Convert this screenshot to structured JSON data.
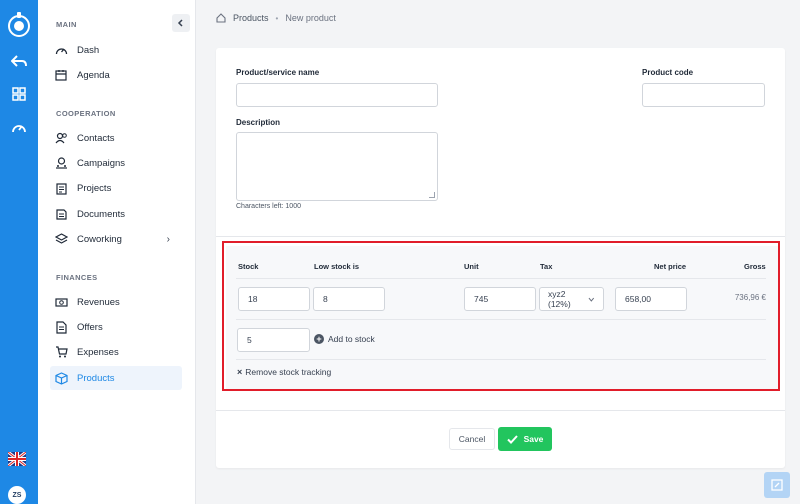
{
  "sidebar": {
    "sections": {
      "main": "MAIN",
      "cooperation": "COOPERATION",
      "finances": "FINANCES"
    },
    "items": [
      {
        "label": "Dash",
        "icon": "gauge-icon"
      },
      {
        "label": "Agenda",
        "icon": "calendar-icon"
      },
      {
        "label": "Contacts",
        "icon": "contacts-icon"
      },
      {
        "label": "Campaigns",
        "icon": "campaigns-icon"
      },
      {
        "label": "Projects",
        "icon": "clipboard-icon"
      },
      {
        "label": "Documents",
        "icon": "documents-icon"
      },
      {
        "label": "Coworking",
        "icon": "layers-icon"
      },
      {
        "label": "Revenues",
        "icon": "revenues-icon"
      },
      {
        "label": "Offers",
        "icon": "offers-icon"
      },
      {
        "label": "Expenses",
        "icon": "cart-icon"
      },
      {
        "label": "Products",
        "icon": "box-icon",
        "active": true
      }
    ]
  },
  "rail": {
    "avatar": "ZS"
  },
  "breadcrumb": {
    "parent": "Products",
    "current": "New product"
  },
  "form": {
    "name_label": "Product/service name",
    "name_value": "",
    "code_label": "Product code",
    "code_value": "",
    "description_label": "Description",
    "chars_left": "Characters left: 1000"
  },
  "stock": {
    "headers": {
      "stock": "Stock",
      "low_stock": "Low stock is",
      "unit": "Unit",
      "tax": "Tax",
      "net_price": "Net price",
      "gross": "Gross"
    },
    "row": {
      "stock": "18",
      "low_stock": "8",
      "unit": "745",
      "tax": "xyz2 (12%)",
      "net_price": "658,00",
      "gross": "736,96 €"
    },
    "add_value": "5",
    "add_label": "Add to stock",
    "remove_label": "Remove stock tracking"
  },
  "footer": {
    "cancel": "Cancel",
    "save": "Save"
  },
  "colors": {
    "primary": "#1e88e5",
    "success": "#22c55e",
    "highlight": "#e11d2a"
  }
}
